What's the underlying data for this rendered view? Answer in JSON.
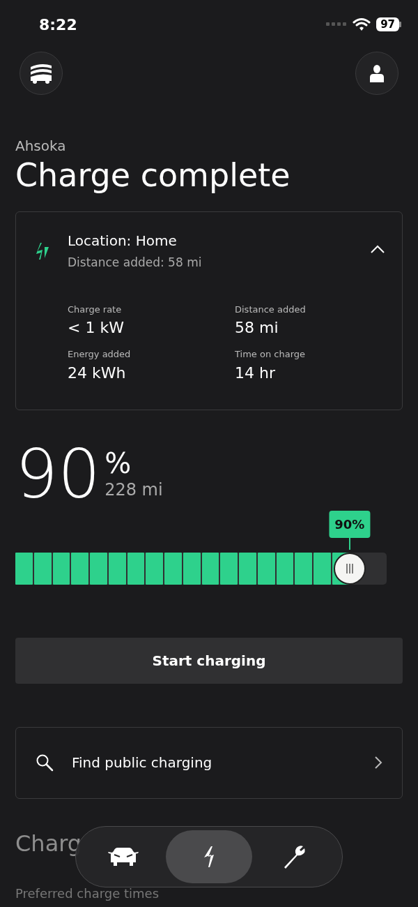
{
  "status_bar": {
    "time": "8:22",
    "battery": "97"
  },
  "vehicle_name": "Ahsoka",
  "title": "Charge complete",
  "session": {
    "location": "Location: Home",
    "subtitle": "Distance added: 58 mi",
    "expanded": true,
    "stats": [
      {
        "label": "Charge rate",
        "value": "< 1 kW"
      },
      {
        "label": "Distance added",
        "value": "58 mi"
      },
      {
        "label": "Energy added",
        "value": "24 kWh"
      },
      {
        "label": "Time on charge",
        "value": "14 hr"
      }
    ]
  },
  "charge": {
    "percent": "90",
    "unit": "%",
    "range": "228 mi",
    "limit_label": "90%",
    "level": 0.9
  },
  "start_button": "Start charging",
  "find_charging": "Find public charging",
  "section_heading": "Charg",
  "settings_row": "Preferred charge times",
  "tabs": [
    {
      "kind": "car",
      "selected": false
    },
    {
      "kind": "charge",
      "selected": true
    },
    {
      "kind": "service",
      "selected": false
    }
  ]
}
